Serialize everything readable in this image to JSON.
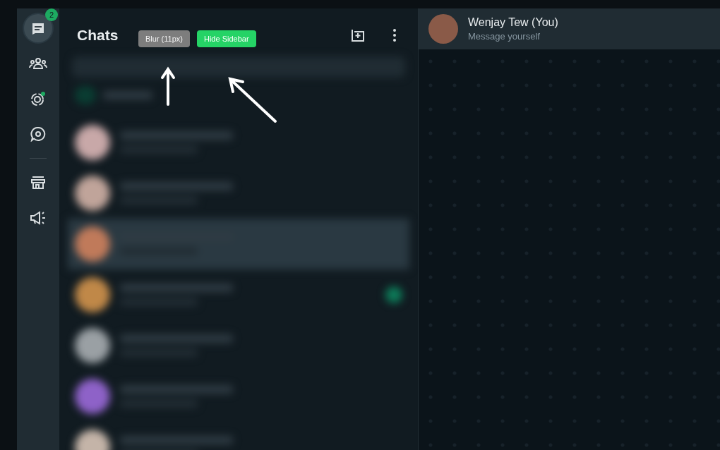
{
  "rail": {
    "badge": "2",
    "items": [
      {
        "kind": "chats",
        "selected": true
      },
      {
        "kind": "communities",
        "selected": false
      },
      {
        "kind": "status",
        "selected": false,
        "dot": true
      },
      {
        "kind": "channels",
        "selected": false
      },
      {
        "kind": "store",
        "selected": false
      },
      {
        "kind": "megaphone",
        "selected": false
      }
    ]
  },
  "panel": {
    "title": "Chats"
  },
  "overlay_buttons": [
    {
      "label": "Blur (11px)",
      "kind": "blur"
    },
    {
      "label": "Hide Sidebar",
      "kind": "hide"
    }
  ],
  "chat_rows": [
    {
      "color": "#c8a8a8",
      "selected": false,
      "unread": false
    },
    {
      "color": "#c0a49a",
      "selected": false,
      "unread": false
    },
    {
      "color": "#c07a5a",
      "selected": true,
      "unread": false
    },
    {
      "color": "#c08848",
      "selected": false,
      "unread": true
    },
    {
      "color": "#9aa0a4",
      "selected": false,
      "unread": false
    },
    {
      "color": "#8e62c8",
      "selected": false,
      "unread": false
    },
    {
      "color": "#c4b4a8",
      "selected": false,
      "unread": false
    }
  ],
  "conversation": {
    "name": "Wenjay Tew (You)",
    "subtitle": "Message yourself"
  }
}
